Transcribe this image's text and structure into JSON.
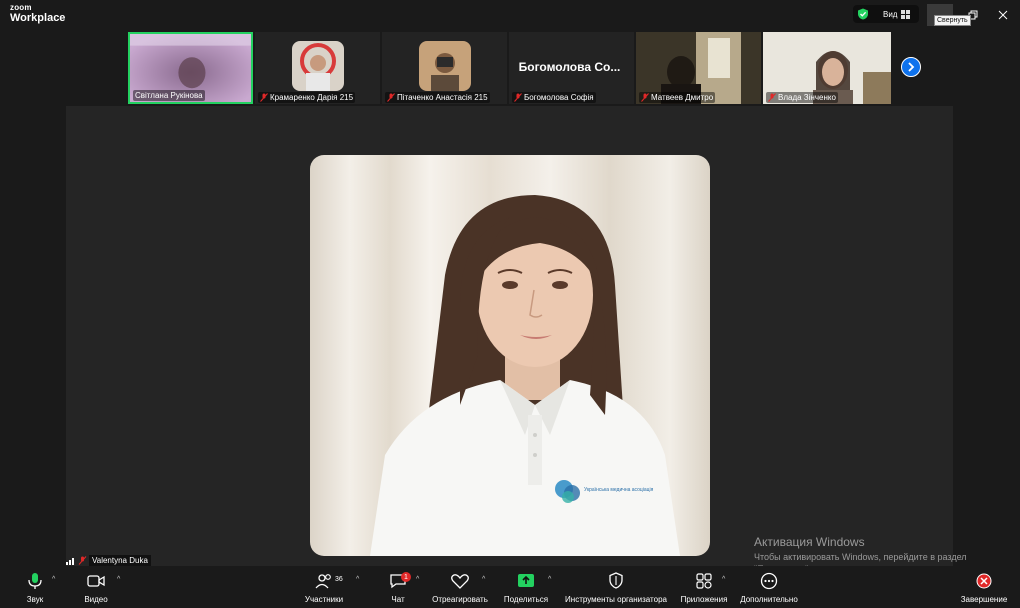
{
  "app": {
    "logo_line1": "zoom",
    "logo_line2": "Workplace"
  },
  "titlebar": {
    "view_label": "Вид",
    "tooltip": "Свернуть"
  },
  "thumbnails": [
    {
      "name": "Світлана Рукінова",
      "muted": false,
      "active": true
    },
    {
      "name": "Крамаренко Дарія 215",
      "muted": true,
      "active": false
    },
    {
      "name": "Пітаченко Анастасія 215",
      "muted": true,
      "active": false
    },
    {
      "name": "Богомолова Софія",
      "muted": true,
      "active": false,
      "display_name": "Богомолова Со..."
    },
    {
      "name": "Матвеев Дмитро",
      "muted": true,
      "active": false
    },
    {
      "name": "Влада Зінченко",
      "muted": true,
      "active": false
    }
  ],
  "stage": {
    "speaker_name": "Valentyna Duka",
    "logo_text": "Українська медична асоціація"
  },
  "watermark": {
    "title": "Активация Windows",
    "body": "Чтобы активировать Windows, перейдите в раздел \"Параметры\"."
  },
  "toolbar": {
    "audio": "Звук",
    "video": "Видео",
    "participants": "Участники",
    "participants_count": "36",
    "chat": "Чат",
    "chat_badge": "1",
    "react": "Отреагировать",
    "share": "Поделиться",
    "host_tools": "Инструменты организатора",
    "apps": "Приложения",
    "more": "Дополнительно",
    "end": "Завершение"
  },
  "colors": {
    "active_green": "#23d160",
    "share_green": "#23d160",
    "next_blue": "#0e72ed",
    "end_red": "#e02828"
  }
}
